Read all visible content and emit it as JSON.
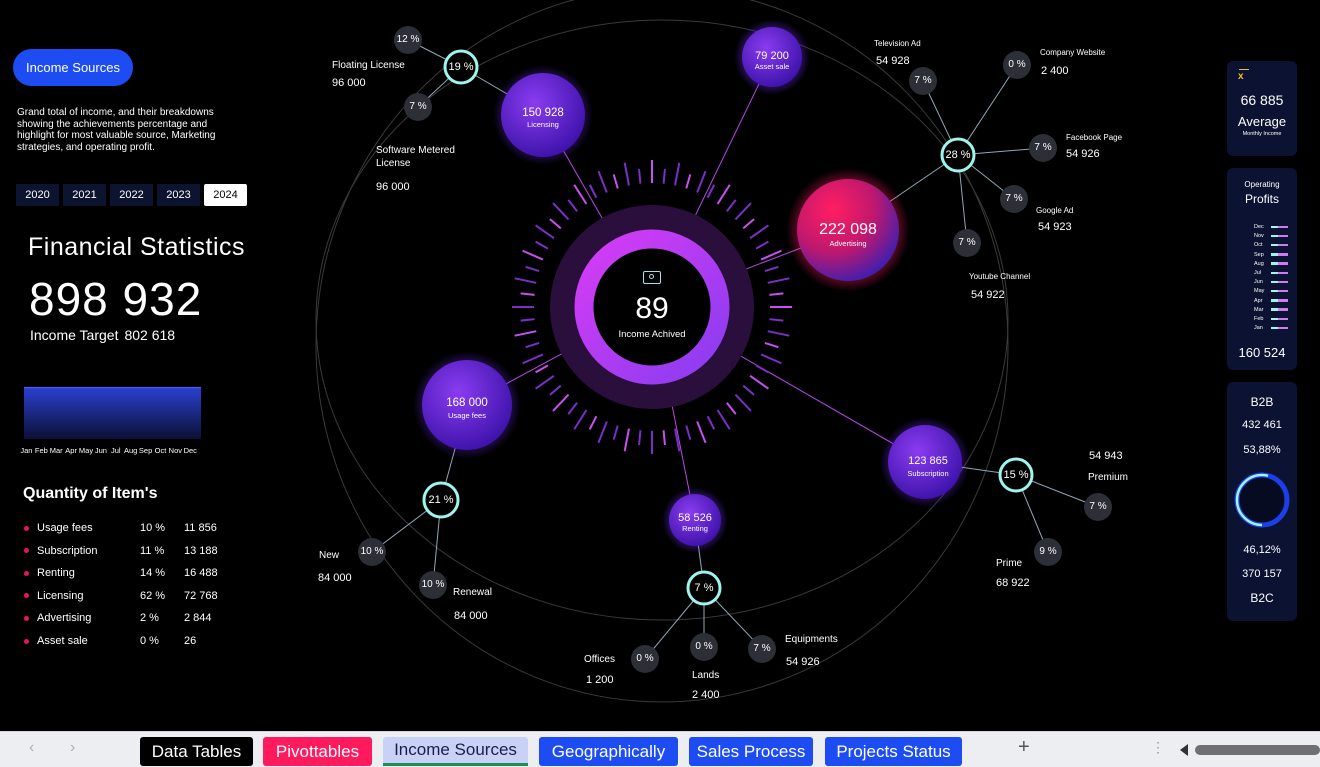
{
  "left": {
    "pill": "Income Sources",
    "description": "Grand total of income, and their breakdowns showing the achievements percentage and highlight for most valuable source, Marketing strategies, and operating profit.",
    "years": [
      "2020",
      "2021",
      "2022",
      "2023",
      "2024"
    ],
    "active_year": "2024",
    "fin_title": "Financial Statistics",
    "fin_total": "898 932",
    "target_label": "Income Target",
    "target_value": "802 618",
    "months": [
      "Jan",
      "Feb",
      "Mar",
      "Apr",
      "May",
      "Jun",
      "Jul",
      "Aug",
      "Sep",
      "Oct",
      "Nov",
      "Dec"
    ],
    "qty_title": "Quantity of Item's",
    "qty_rows": [
      {
        "name": "Usage fees",
        "pct": "10 %",
        "qty": "11 856"
      },
      {
        "name": "Subscription",
        "pct": "11 %",
        "qty": "13 188"
      },
      {
        "name": "Renting",
        "pct": "14 %",
        "qty": "16 488"
      },
      {
        "name": "Licensing",
        "pct": "62 %",
        "qty": "72 768"
      },
      {
        "name": "Advertising",
        "pct": "2 %",
        "qty": "2 844"
      },
      {
        "name": "Asset sale",
        "pct": "0 %",
        "qty": "26"
      }
    ]
  },
  "center": {
    "value": "89",
    "label": "Income Achived",
    "icon": "money-icon"
  },
  "hubs": {
    "licensing": {
      "value": "150 928",
      "label": "Licensing"
    },
    "asset": {
      "value": "79 200",
      "label": "Asset sale"
    },
    "advertising": {
      "value": "222 098",
      "label": "Advertising"
    },
    "usage": {
      "value": "168 000",
      "label": "Usage fees"
    },
    "renting": {
      "value": "58 526",
      "label": "Renting"
    },
    "subscription": {
      "value": "123 865",
      "label": "Subscription"
    }
  },
  "satellites": {
    "lic_ring": "19 %",
    "lic_a": "12 %",
    "lic_b": "7 %",
    "lic_floating_label": "Floating License",
    "lic_floating_value": "96 000",
    "lic_metered_label": "Software Metered License",
    "lic_metered_value": "96 000",
    "adv_ring": "28 %",
    "adv_tv_pct": "7 %",
    "adv_tv_label": "Television Ad",
    "adv_tv_value": "54 928",
    "adv_web_pct": "0 %",
    "adv_web_label": "Company Website",
    "adv_web_value": "2 400",
    "adv_fb_pct": "7 %",
    "adv_fb_label": "Facebook Page",
    "adv_fb_value": "54 926",
    "adv_g_pct": "7 %",
    "adv_g_label": "Google Ad",
    "adv_g_value": "54 923",
    "adv_yt_pct": "7 %",
    "adv_yt_label": "Youtube Channel",
    "adv_yt_value": "54 922",
    "use_ring": "21 %",
    "use_new_pct": "10 %",
    "use_new_label": "New",
    "use_new_value": "84 000",
    "use_ren_pct": "10 %",
    "use_ren_label": "Renewal",
    "use_ren_value": "84 000",
    "rent_ring": "7 %",
    "rent_off_pct": "0 %",
    "rent_off_label": "Offices",
    "rent_off_value": "1 200",
    "rent_land_pct": "0 %",
    "rent_land_label": "Lands",
    "rent_land_value": "2 400",
    "rent_eq_pct": "7 %",
    "rent_eq_label": "Equipments",
    "rent_eq_value": "54 926",
    "sub_ring": "15 %",
    "sub_prem_pct": "7 %",
    "sub_prem_label": "Premium",
    "sub_prem_value": "54 943",
    "sub_prime_pct": "9 %",
    "sub_prime_label": "Prime",
    "sub_prime_value": "68 922"
  },
  "right": {
    "avg_value": "66 885",
    "avg_label": "Average",
    "avg_sub": "Monthly Income",
    "op_small": "Operating",
    "op_title": "Profits",
    "op_months": [
      "Dec",
      "Nov",
      "Oct",
      "Sep",
      "Aug",
      "Jul",
      "Jun",
      "May",
      "Apr",
      "Mar",
      "Feb",
      "Jan"
    ],
    "op_value": "160 524",
    "b2b_label": "B2B",
    "b2b_value": "432 461",
    "b2b_pct": "53,88%",
    "b2c_pct": "46,12%",
    "b2c_value": "370 157",
    "b2c_label": "B2C"
  },
  "tabs": [
    "Data Tables",
    "Pivottables",
    "Income Sources",
    "Geographically",
    "Sales Process",
    "Projects Status"
  ],
  "colors": {
    "accent": "#1d4cf2",
    "pink": "#ff1a5e",
    "cyan": "#9ff4ee",
    "purple": "#a53bf0"
  }
}
